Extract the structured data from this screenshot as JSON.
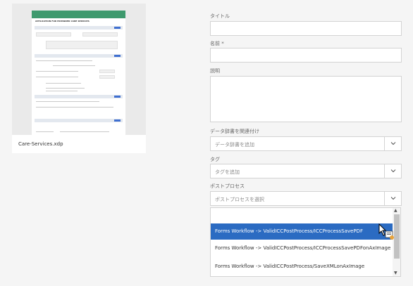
{
  "card": {
    "filename": "Care-Services.xdp"
  },
  "thumbnail": {
    "title": "APPLICATION FOR EXPANDED CARE SERVICES",
    "accent_color": "#3e9a6e",
    "button_color": "#3f6fd0"
  },
  "form": {
    "title_label": "タイトル",
    "title_value": "",
    "name_label": "名前 *",
    "name_value": "",
    "description_label": "説明",
    "description_value": "",
    "dictionary_label": "データ辞書を関連付け",
    "dictionary_placeholder": "データ辞書を追加",
    "tags_label": "タグ",
    "tags_placeholder": "タグを追加",
    "postprocess_label": "ポストプロセス",
    "postprocess_placeholder": "ポストプロセスを選択"
  },
  "dropdown": {
    "options": [
      "Forms Workflow -> ValidICCPostProcess/ICCProcessSavePDF",
      "Forms Workflow -> ValidICCPostProcess/ICCProcessSavePDFonAxImage",
      "Forms Workflow -> ValidICCPostProcess/SaveXMLonAxImage"
    ],
    "selected_index": 0,
    "highlight_color": "#2b6bc2"
  }
}
